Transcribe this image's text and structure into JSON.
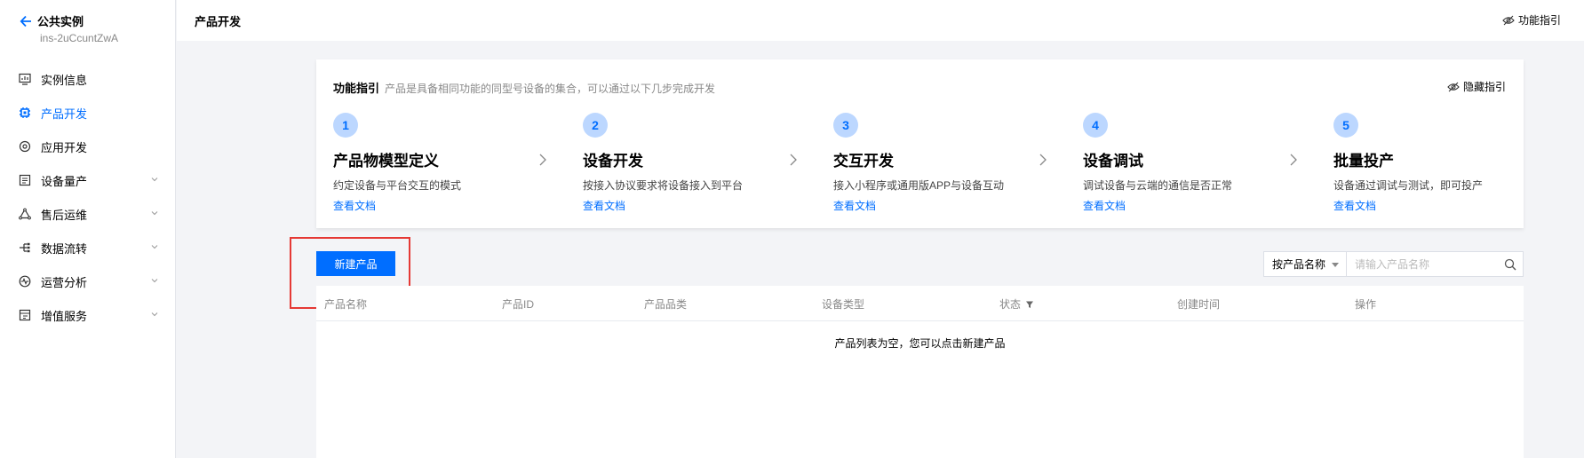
{
  "instance": {
    "title": "公共实例",
    "id": "ins-2uCcuntZwA"
  },
  "nav": [
    {
      "label": "实例信息",
      "icon": "monitor-icon",
      "active": false,
      "expandable": false
    },
    {
      "label": "产品开发",
      "icon": "chip-icon",
      "active": true,
      "expandable": false
    },
    {
      "label": "应用开发",
      "icon": "app-icon",
      "active": false,
      "expandable": false
    },
    {
      "label": "设备量产",
      "icon": "list-icon",
      "active": false,
      "expandable": true
    },
    {
      "label": "售后运维",
      "icon": "triangle-nodes-icon",
      "active": false,
      "expandable": true
    },
    {
      "label": "数据流转",
      "icon": "flow-icon",
      "active": false,
      "expandable": true
    },
    {
      "label": "运营分析",
      "icon": "pulse-icon",
      "active": false,
      "expandable": true
    },
    {
      "label": "增值服务",
      "icon": "service-icon",
      "active": false,
      "expandable": true
    }
  ],
  "topbar": {
    "title": "产品开发",
    "guide_label": "功能指引"
  },
  "guide": {
    "title": "功能指引",
    "description": "产品是具备相同功能的同型号设备的集合，可以通过以下几步完成开发",
    "hide_label": "隐藏指引",
    "steps": [
      {
        "num": "1",
        "title": "产品物模型定义",
        "desc": "约定设备与平台交互的模式",
        "link": "查看文档"
      },
      {
        "num": "2",
        "title": "设备开发",
        "desc": "按接入协议要求将设备接入到平台",
        "link": "查看文档"
      },
      {
        "num": "3",
        "title": "交互开发",
        "desc": "接入小程序或通用版APP与设备互动",
        "link": "查看文档"
      },
      {
        "num": "4",
        "title": "设备调试",
        "desc": "调试设备与云端的通信是否正常",
        "link": "查看文档"
      },
      {
        "num": "5",
        "title": "批量投产",
        "desc": "设备通过调试与测试，即可投产",
        "link": "查看文档"
      }
    ]
  },
  "toolbar": {
    "new_button": "新建产品",
    "search_select": "按产品名称",
    "search_placeholder": "请输入产品名称"
  },
  "table": {
    "columns": [
      "产品名称",
      "产品ID",
      "产品品类",
      "设备类型",
      "状态",
      "创建时间",
      "操作"
    ],
    "empty_message": "产品列表为空，您可以点击新建产品"
  },
  "colors": {
    "accent": "#006eff",
    "highlight_box": "#e53935"
  }
}
